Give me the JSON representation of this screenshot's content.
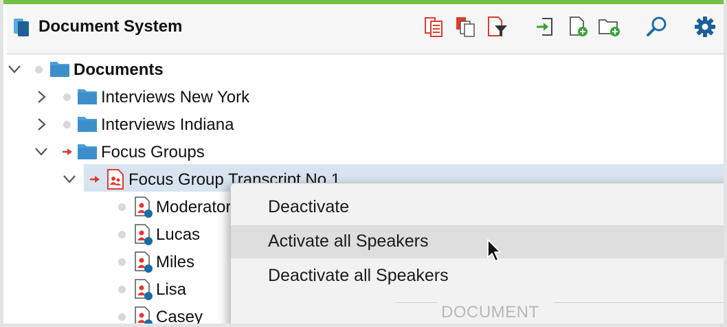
{
  "window": {
    "title": "Document System"
  },
  "toolbar": {
    "buttons": [
      {
        "name": "document-list-icon"
      },
      {
        "name": "copy-documents-icon"
      },
      {
        "name": "filter-documents-icon"
      },
      {
        "name": "import-icon"
      },
      {
        "name": "new-document-icon"
      },
      {
        "name": "new-document-group-icon"
      },
      {
        "name": "search-icon"
      },
      {
        "name": "settings-gear-icon"
      }
    ]
  },
  "tree": {
    "root": {
      "label": "Documents"
    },
    "groups": [
      {
        "label": "Interviews New York",
        "expanded": false
      },
      {
        "label": "Interviews Indiana",
        "expanded": false
      },
      {
        "label": "Focus Groups",
        "expanded": true,
        "active": true
      }
    ],
    "document": {
      "label": "Focus Group Transcript No 1",
      "active": true
    },
    "speakers": [
      {
        "label": "Moderator"
      },
      {
        "label": "Lucas"
      },
      {
        "label": "Miles"
      },
      {
        "label": "Lisa"
      },
      {
        "label": "Casey"
      }
    ]
  },
  "context_menu": {
    "items": [
      {
        "label": "Deactivate"
      },
      {
        "label": "Activate all Speakers",
        "highlighted": true
      },
      {
        "label": "Deactivate all Speakers"
      }
    ],
    "section_header": "DOCUMENT"
  },
  "colors": {
    "accent": "#74c043",
    "folder": "#4a9fd8",
    "document_red": "#e03a2f",
    "toolbar_blue": "#1a6ca8",
    "selection": "#d8e4f0"
  }
}
